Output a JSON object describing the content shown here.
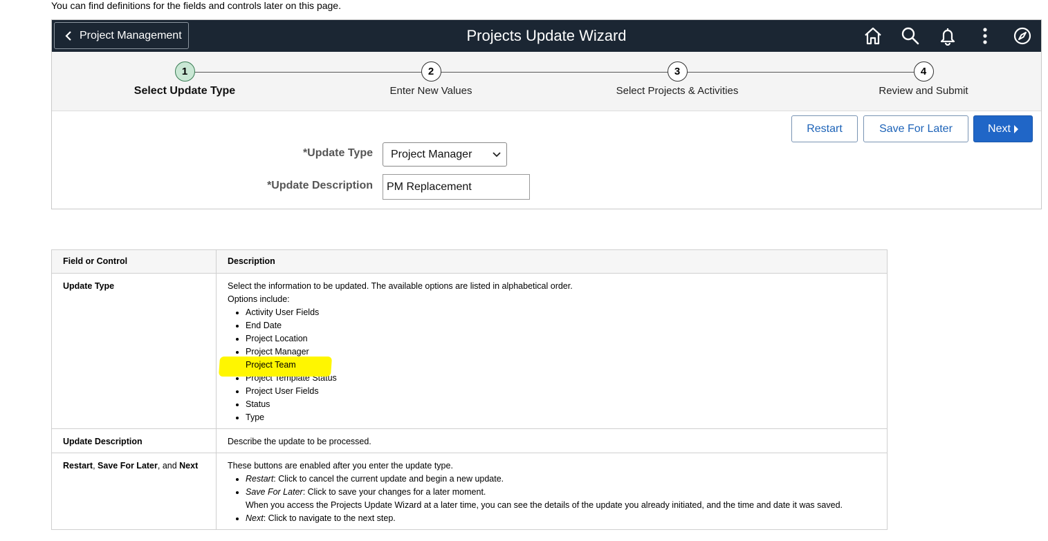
{
  "intro_text": "You can find definitions for the fields and controls later on this page.",
  "banner": {
    "back_label": "Project Management",
    "title": "Projects Update Wizard",
    "icons": [
      "home-icon",
      "search-icon",
      "notification-bell-icon",
      "actions-menu-icon",
      "navbar-compass-icon"
    ]
  },
  "train": {
    "steps": [
      {
        "number": "1",
        "label": "Select Update Type",
        "active": true
      },
      {
        "number": "2",
        "label": "Enter New Values",
        "active": false
      },
      {
        "number": "3",
        "label": "Select Projects & Activities",
        "active": false
      },
      {
        "number": "4",
        "label": "Review and Submit",
        "active": false
      }
    ]
  },
  "buttons": {
    "restart": "Restart",
    "save_for_later": "Save For Later",
    "next": "Next"
  },
  "form": {
    "update_type_label": "*Update Type",
    "update_type_value": "Project Manager",
    "update_description_label": "*Update Description",
    "update_description_value": "PM Replacement"
  },
  "definitions": {
    "headers": [
      "Field or Control",
      "Description"
    ],
    "update_type": {
      "field": "Update Type",
      "desc_line1": "Select the information to be updated. The available options are listed in alphabetical order.",
      "desc_line2": "Options include:",
      "options": [
        "Activity User Fields",
        "End Date",
        "Project Location",
        "Project Manager",
        "Project Team",
        "Project Template Status",
        "Project User Fields",
        "Status",
        "Type"
      ],
      "highlighted_option": "Project Team"
    },
    "update_description": {
      "field": "Update Description",
      "desc": "Describe the update to be processed."
    },
    "buttons_row": {
      "field_restart": "Restart",
      "field_sep1": ", ",
      "field_save": "Save For Later",
      "field_sep2": ", and ",
      "field_next": "Next",
      "intro": "These buttons are enabled after you enter the update type.",
      "restart_term": "Restart",
      "restart_desc": ": Click to cancel the current update and begin a new update.",
      "save_term": "Save For Later",
      "save_desc": ": Click to save your changes for a later moment.",
      "save_note": "When you access the Projects Update Wizard at a later time, you can see the details of the update you already initiated, and the time and date it was saved.",
      "next_term": "Next",
      "next_desc": ": Click to navigate to the next step."
    }
  },
  "colors": {
    "banner_bg": "#1b2633",
    "primary_button": "#2066c7",
    "active_step": "#c9e7d4",
    "highlight": "#fff600"
  }
}
